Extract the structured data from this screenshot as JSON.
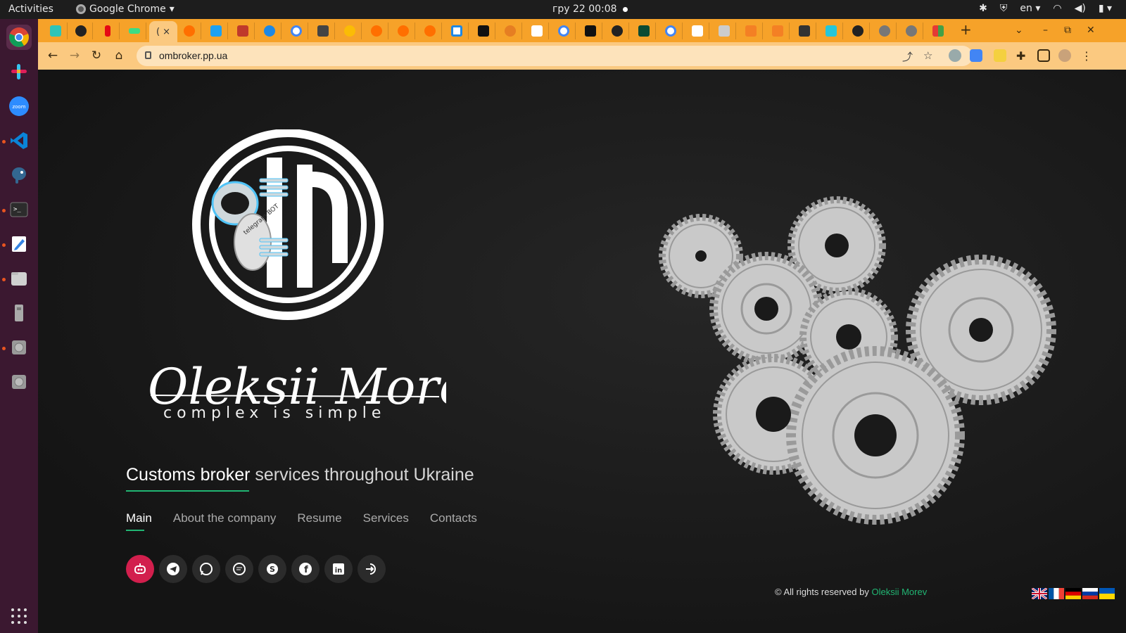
{
  "os": {
    "activities": "Activities",
    "app_menu": "Google Chrome",
    "clock": "гру 22  00:08",
    "language": "en"
  },
  "browser": {
    "url": "ombroker.pp.ua",
    "active_tab_label": "( ×",
    "new_tab": "+"
  },
  "page": {
    "logo_signature": "Oleksii Morev",
    "logo_badge": "telegram BOT",
    "tagline": "complex is simple",
    "headline_highlight": "Customs broker",
    "headline_rest": " services throughout Ukraine",
    "nav": [
      {
        "label": "Main",
        "active": true
      },
      {
        "label": "About the company",
        "active": false
      },
      {
        "label": "Resume",
        "active": false
      },
      {
        "label": "Services",
        "active": false
      },
      {
        "label": "Contacts",
        "active": false
      }
    ],
    "social_icons": [
      "bot-icon",
      "telegram-icon",
      "whatsapp-icon",
      "chat-icon",
      "skype-icon",
      "facebook-icon",
      "linkedin-icon",
      "login-icon"
    ],
    "footer_prefix": "© All rights reserved by ",
    "footer_link": "Oleksii Morev",
    "languages": [
      "en",
      "fr",
      "de",
      "ru",
      "ua"
    ]
  },
  "colors": {
    "accent_green": "#21b573",
    "bot_red": "#d21f4d",
    "tab_orange": "#f6a229"
  }
}
